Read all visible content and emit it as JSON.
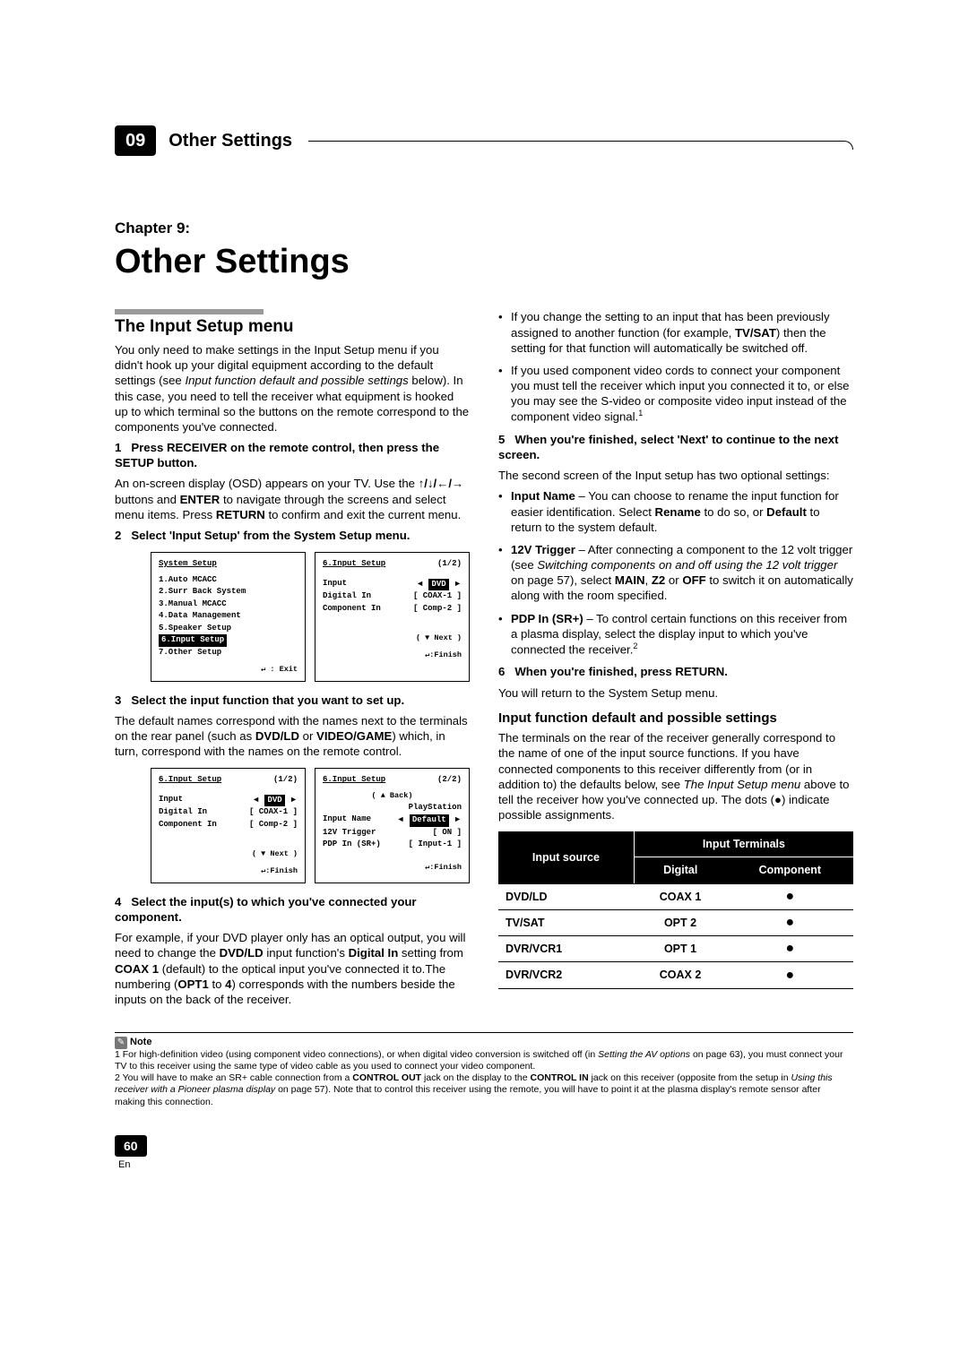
{
  "header": {
    "chapter_num": "09",
    "header_title": "Other Settings"
  },
  "chapter": {
    "label": "Chapter 9:",
    "title": "Other Settings"
  },
  "left": {
    "h2": "The Input Setup menu",
    "intro_a": "You only need to make settings in the Input Setup menu if you didn't hook up your digital equipment according to the default settings (see ",
    "intro_i": "Input function default and possible settings",
    "intro_b": " below). In this case, you need to tell the receiver what equipment is hooked up to which terminal so the buttons on the remote correspond to the components you've connected.",
    "s1_num": "1",
    "s1": "Press RECEIVER on the remote control, then press the SETUP button.",
    "s1_p_a": "An on-screen display (OSD) appears on your TV. Use the ",
    "s1_p_arrows": "↑/↓/←/→",
    "s1_p_b": " buttons and ",
    "s1_p_enter": "ENTER",
    "s1_p_c": " to navigate through the screens and select menu items. Press ",
    "s1_p_return": "RETURN",
    "s1_p_d": " to confirm and exit the current menu.",
    "s2_num": "2",
    "s2": "Select 'Input Setup' from the System Setup menu.",
    "s3_num": "3",
    "s3": "Select the input function that you want to set up.",
    "s3_p_a": "The default names correspond with the names next to the terminals on the rear panel (such as ",
    "s3_p_b1": "DVD/LD",
    "s3_p_or": " or ",
    "s3_p_b2": "VIDEO/GAME",
    "s3_p_c": ") which, in turn, correspond with the names on the remote control.",
    "s4_num": "4",
    "s4": "Select the input(s) to which you've connected your component.",
    "s4_p_a": "For example, if your DVD player only has an optical output, you will need to change the ",
    "s4_p_b1": "DVD/LD",
    "s4_p_b": " input function's ",
    "s4_p_b2": "Digital In",
    "s4_p_c": " setting from ",
    "s4_p_b3": "COAX 1",
    "s4_p_d": " (default) to the optical input you've connected it to.The numbering (",
    "s4_p_b4": "OPT1",
    "s4_p_e": " to ",
    "s4_p_b5": "4",
    "s4_p_f": ") corresponds with the numbers beside the inputs on the back of the receiver."
  },
  "osd1": {
    "title": "System  Setup",
    "items": [
      "1.Auto  MCACC",
      "2.Surr  Back  System",
      "3.Manual  MCACC",
      "4.Data  Management",
      "5.Speaker  Setup",
      "6.Input  Setup",
      "7.Other  Setup"
    ],
    "hl_index": 5,
    "exit": "↵ : Exit"
  },
  "osd2": {
    "title": "6.Input  Setup",
    "page": "(1/2)",
    "rows": [
      {
        "l": "Input",
        "r_hl": "DVD",
        "arrows": true
      },
      {
        "l": "Digital  In",
        "r": "[  COAX-1   ]"
      },
      {
        "l": "Component  In",
        "r": "[  Comp-2   ]"
      }
    ],
    "next": "( ▼ Next )",
    "finish": "↵:Finish"
  },
  "osd3": {
    "title": "6.Input  Setup",
    "page": "(1/2)",
    "rows": [
      {
        "l": "Input",
        "r_hl": "DVD",
        "arrows": true
      },
      {
        "l": "Digital  In",
        "r": "[  COAX-1   ]"
      },
      {
        "l": "Component  In",
        "r": "[  Comp-2   ]"
      }
    ],
    "next": "( ▼ Next )",
    "finish": "↵:Finish"
  },
  "osd4": {
    "title": "6.Input  Setup",
    "page": "(2/2)",
    "back": "( ▲ Back)",
    "pre": "PlayStation",
    "rows": [
      {
        "l": "Input  Name",
        "r_hl": "Default",
        "arrows": true
      },
      {
        "l": "12V  Trigger",
        "r": "[     ON     ]"
      },
      {
        "l": "PDP  In  (SR+)",
        "r": "[  Input-1  ]"
      }
    ],
    "finish": "↵:Finish"
  },
  "right": {
    "b1_a": "If you change the setting to an input that has been previously assigned to another function (for example, ",
    "b1_b": "TV/SAT",
    "b1_c": ") then the setting for that function will automatically be switched off.",
    "b2_a": "If you used component video cords to connect your component you must tell the receiver which input you connected it to, or else you may see the S-video or composite video input instead of the component video signal.",
    "s5_num": "5",
    "s5": "When you're finished, select 'Next' to continue to the next screen.",
    "s5_p": "The second screen of the Input setup has two optional settings:",
    "li1_t": "Input Name",
    "li1_a": " – You can choose to rename the input function for easier identification. Select ",
    "li1_b": "Rename",
    "li1_c": " to do so, or ",
    "li1_d": "Default",
    "li1_e": " to return to the system default.",
    "li2_t": "12V Trigger",
    "li2_a": " – After connecting a component to the 12 volt trigger (see ",
    "li2_i": "Switching components on and off using the 12 volt trigger",
    "li2_b": " on page 57), select ",
    "li2_c": "MAIN",
    "li2_d": ", ",
    "li2_e": "Z2",
    "li2_f": " or ",
    "li2_g": "OFF",
    "li2_h": " to switch it on automatically along with the room specified.",
    "li3_t": "PDP In (SR+)",
    "li3_a": " – To control certain functions on this receiver from a plasma display, select the display input to which you've connected the receiver.",
    "s6_num": "6",
    "s6": "When you're finished, press RETURN.",
    "s6_p": "You will return to the System Setup menu.",
    "h3": "Input function default and possible settings",
    "h3_p_a": "The terminals on the rear of the receiver generally correspond to the name of one of the input source functions. If you have connected components to this receiver differently from (or in addition to) the defaults below, see ",
    "h3_p_i": "The Input Setup menu",
    "h3_p_b": " above to tell the receiver how you've connected up. The dots (",
    "h3_dot": "●",
    "h3_p_c": ") indicate possible assignments."
  },
  "table": {
    "h_src": "Input source",
    "h_term": "Input Terminals",
    "h_dig": "Digital",
    "h_comp": "Component",
    "rows": [
      {
        "src": "DVD/LD",
        "dig": "COAX 1",
        "comp": "●"
      },
      {
        "src": "TV/SAT",
        "dig": "OPT 2",
        "comp": "●"
      },
      {
        "src": "DVR/VCR1",
        "dig": "OPT 1",
        "comp": "●"
      },
      {
        "src": "DVR/VCR2",
        "dig": "COAX 2",
        "comp": "●"
      }
    ]
  },
  "note": {
    "label": "Note",
    "n1_a": "1 For high-definition video (using component video connections), or when digital video conversion is switched off (in ",
    "n1_i": "Setting the AV options",
    "n1_b": " on page 63), you must connect your TV to this receiver using the same type of video cable as you used to connect your video component.",
    "n2_a": "2 You will have to make an SR+ cable connection from a ",
    "n2_b1": "CONTROL OUT",
    "n2_b": " jack on the display to the ",
    "n2_b2": "CONTROL IN",
    "n2_c": " jack on this receiver (opposite from the setup in ",
    "n2_i": "Using this receiver with a Pioneer plasma display",
    "n2_d": " on page 57). Note that to control this receiver using the remote, you will have to point it at the plasma display's remote sensor after making this connection."
  },
  "footer": {
    "page": "60",
    "lang": "En"
  }
}
